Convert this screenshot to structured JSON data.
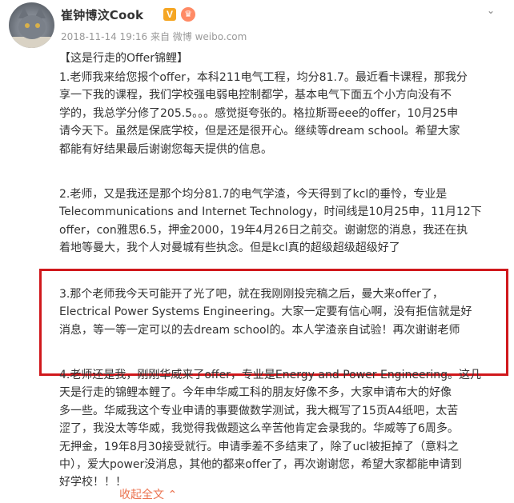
{
  "user": {
    "name": "崔钟博汶Cook",
    "verified_badge": "V",
    "crown_badge": "♛",
    "timestamp": "2018-11-14 19:16",
    "source": "来自 微博 weibo.com"
  },
  "post": {
    "title": "【这是行走的Offer锦鲤】",
    "para1": [
      "1.老师我来给您报个offer，本科211电气工程，均分81.7。最近看卡课程，那我分",
      "享一下我的课程，我们学校强电弱电控制都学，基本电气下面五个小方向没有不",
      "学的，我总学分修了205.5。。。感觉挺夸张的。格拉斯哥eee的offer，10月25申",
      "请今天下。虽然是保底学校，但是还是很开心。继续等dream school。希望大家",
      "都能有好结果最后谢谢您每天提供的信息。"
    ],
    "para2": [
      "2.老师，又是我还是那个均分81.7的电气学渣，今天得到了kcl的垂怜，专业是",
      "Telecommunications and Internet Technology，时间线是10月25申，11月12下",
      "offer，con雅思6.5，押金2000，19年4月26日之前交。谢谢您的消息，我还在执",
      "着地等曼大，我个人对曼城有些执念。但是kcl真的超级超级超级好了"
    ],
    "para3": [
      "3.那个老师我今天可能开了光了吧，就在我刚刚投完稿之后，曼大来offer了，",
      "Electrical Power Systems Engineering。大家一定要有信心啊，没有拒信就是好",
      "消息，等一等一定可以的去dream school的。本人学渣亲自试验！再次谢谢老师"
    ],
    "para4": [
      "4.老师还是我，刚刚华威来了offer，专业是Energy and Power Engineering。这几",
      "天是行走的锦鲤本鲤了。今年申华威工科的朋友好像不多，大家申请布大的好像",
      "多一些。华威我这个专业申请的事要做数学测试，我大概写了15页A4纸吧，太苦",
      "涩了，我没太等华威，我觉得我做题这么辛苦他肯定会录我的。华威等了6周多。",
      "无押金，19年8月30接受就行。申请季差不多结束了，除了ucl被拒掉了（意料之",
      "中），爱大power没消息，其他的都来offer了，再次谢谢您，希望大家都能申请到",
      "好学校！！！"
    ],
    "expand_label": "收起全文",
    "expand_icon": "⌃"
  },
  "icons": {
    "menu_chevron": "chevron-down-icon"
  }
}
